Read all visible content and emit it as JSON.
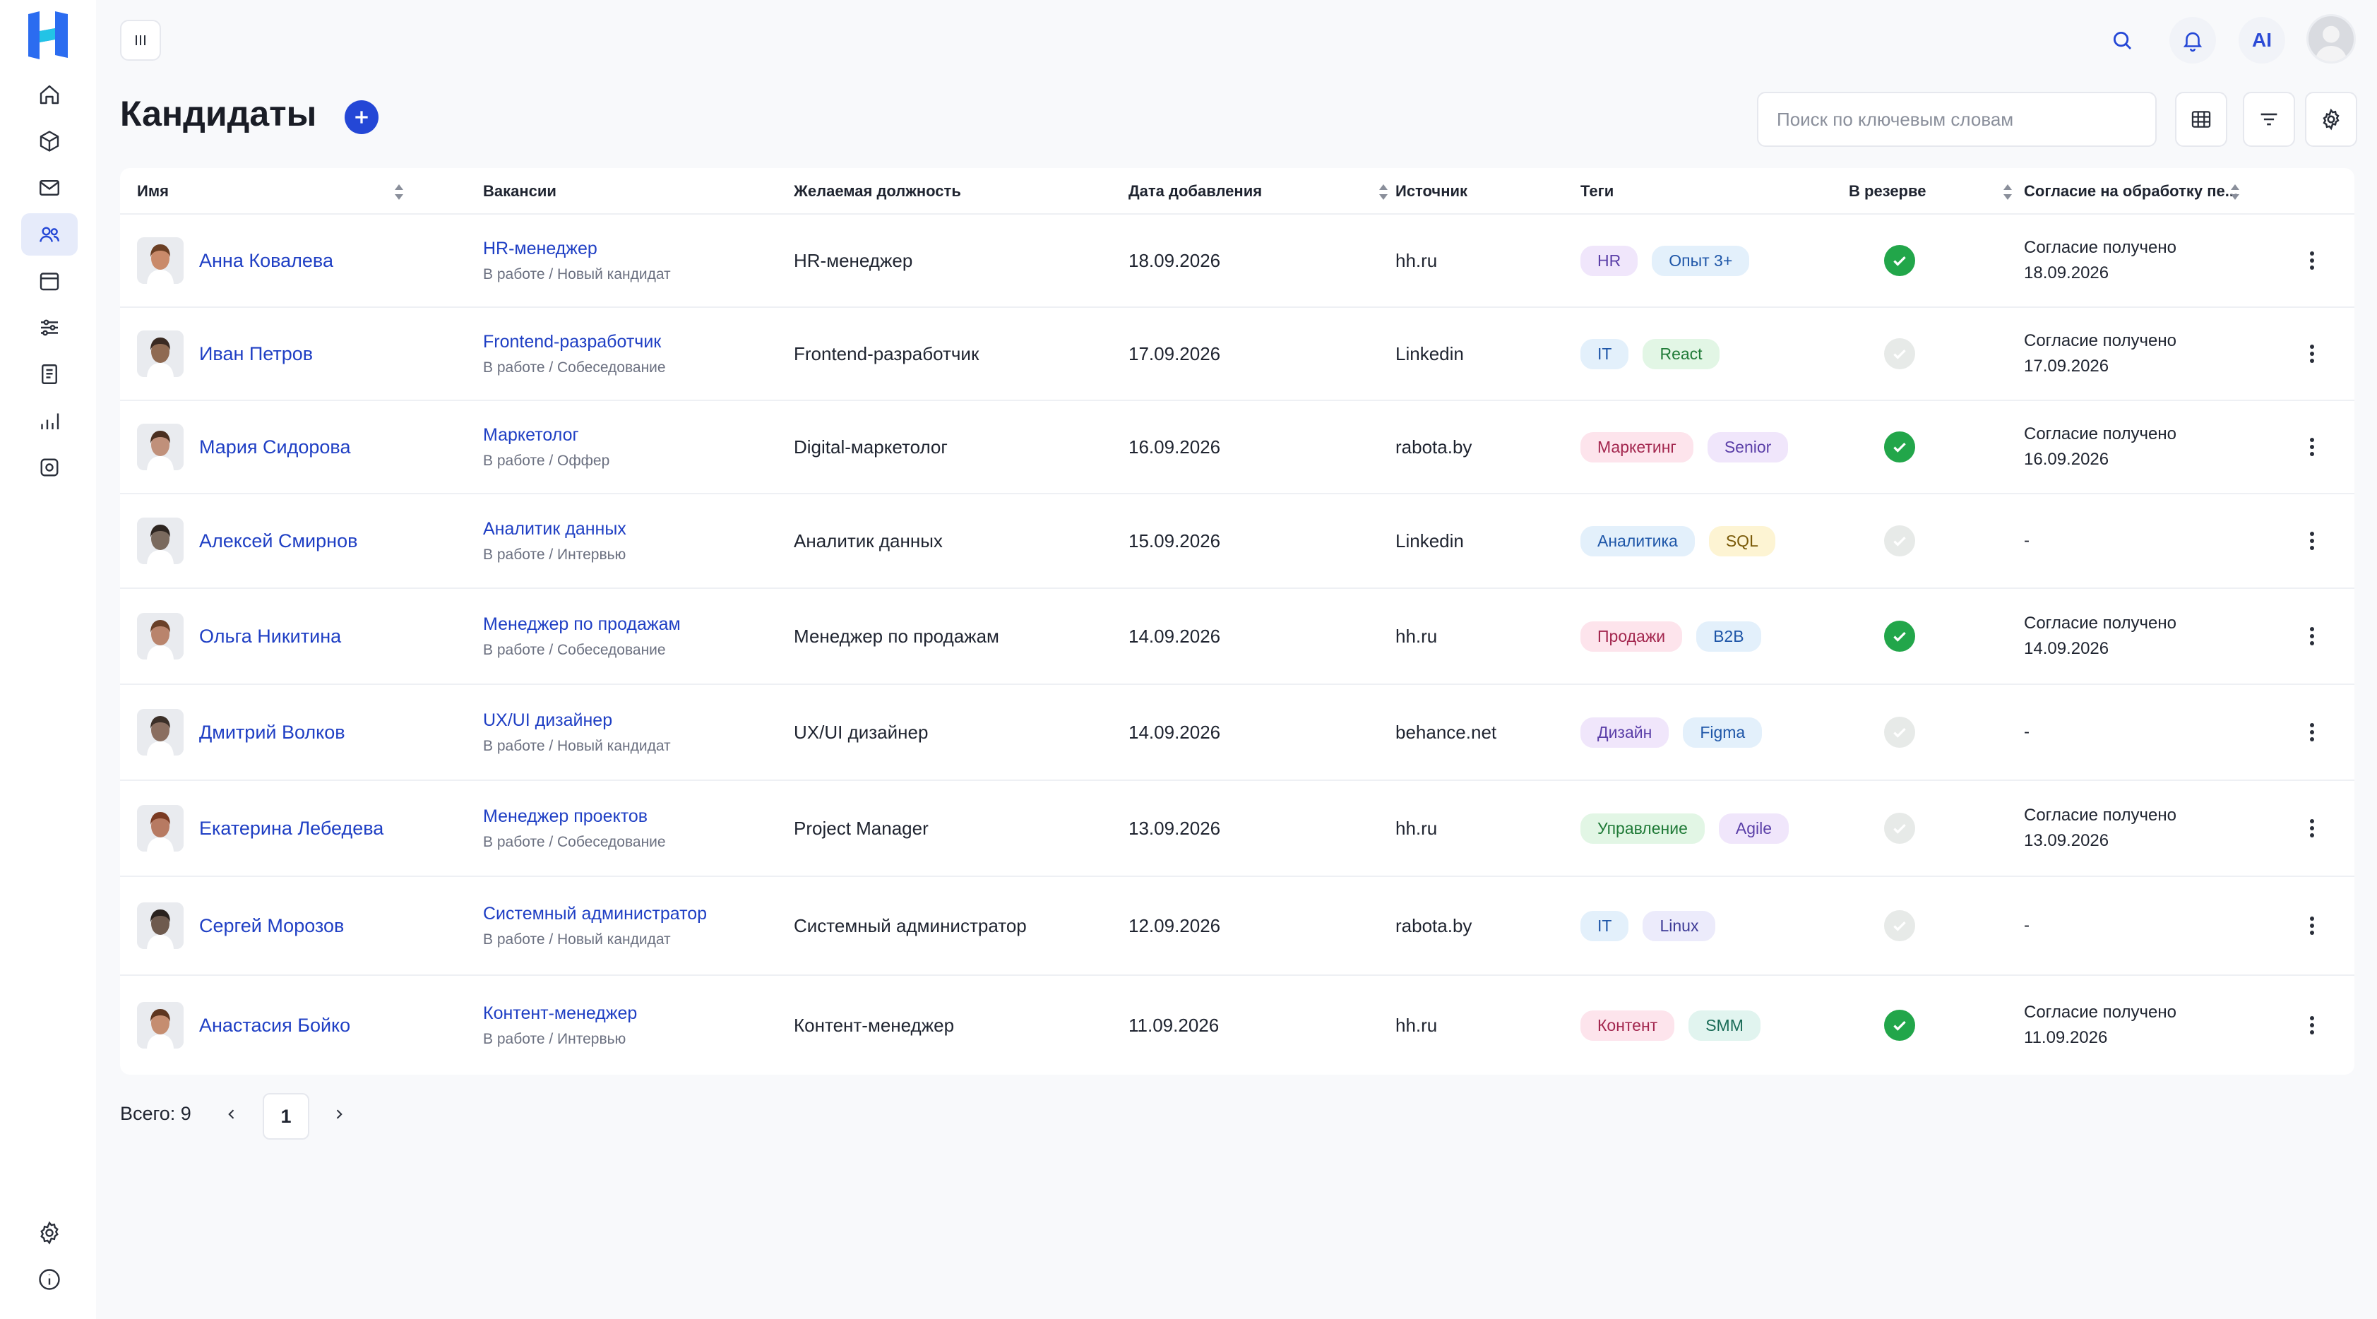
{
  "header": {
    "title": "Кандидаты",
    "ai_label": "AI",
    "search_placeholder": "Поиск по ключевым словам"
  },
  "sidebar": {
    "items": [
      {
        "icon": "home-icon"
      },
      {
        "icon": "cube-icon"
      },
      {
        "icon": "mail-icon"
      },
      {
        "icon": "users-icon",
        "active": true
      },
      {
        "icon": "calendar-icon"
      },
      {
        "icon": "sliders-icon"
      },
      {
        "icon": "document-icon"
      },
      {
        "icon": "bar-chart-icon"
      },
      {
        "icon": "cog-icon"
      }
    ],
    "bottom": [
      {
        "icon": "settings-icon"
      },
      {
        "icon": "info-icon"
      }
    ]
  },
  "table": {
    "columns": {
      "name": "Имя",
      "vacancies": "Вакансии",
      "position": "Желаемая должность",
      "date": "Дата добавления",
      "source": "Источник",
      "tags": "Теги",
      "reserve": "В резерве",
      "consent": "Согласие на обработку пе..."
    },
    "rows": [
      {
        "name": "Анна Ковалева",
        "vacancy": "HR-менеджер",
        "status": "В работе / Новый кандидат",
        "position": "HR-менеджер",
        "date": "18.09.2026",
        "source": "hh.ru",
        "tags": [
          {
            "label": "HR",
            "color": "purple"
          },
          {
            "label": "Опыт 3+",
            "color": "blue"
          }
        ],
        "reserve": true,
        "consent_line1": "Согласие получено",
        "consent_line2": "18.09.2026"
      },
      {
        "name": "Иван Петров",
        "vacancy": "Frontend-разработчик",
        "status": "В работе / Собеседование",
        "position": "Frontend-разработчик",
        "date": "17.09.2026",
        "source": "Linkedin",
        "tags": [
          {
            "label": "IT",
            "color": "blue"
          },
          {
            "label": "React",
            "color": "green"
          }
        ],
        "reserve": false,
        "consent_line1": "Согласие получено",
        "consent_line2": "17.09.2026"
      },
      {
        "name": "Мария Сидорова",
        "vacancy": "Маркетолог",
        "status": "В работе / Оффер",
        "position": "Digital-маркетолог",
        "date": "16.09.2026",
        "source": "rabota.by",
        "tags": [
          {
            "label": "Маркетинг",
            "color": "pink"
          },
          {
            "label": "Senior",
            "color": "purple"
          }
        ],
        "reserve": true,
        "consent_line1": "Согласие получено",
        "consent_line2": "16.09.2026"
      },
      {
        "name": "Алексей Смирнов",
        "vacancy": "Аналитик данных",
        "status": "В работе / Интервью",
        "position": "Аналитик данных",
        "date": "15.09.2026",
        "source": "Linkedin",
        "tags": [
          {
            "label": "Аналитика",
            "color": "blue"
          },
          {
            "label": "SQL",
            "color": "yellow"
          }
        ],
        "reserve": false,
        "consent_line1": "-",
        "consent_line2": ""
      },
      {
        "name": "Ольга Никитина",
        "vacancy": "Менеджер по продажам",
        "status": "В работе / Собеседование",
        "position": "Менеджер по продажам",
        "date": "14.09.2026",
        "source": "hh.ru",
        "tags": [
          {
            "label": "Продажи",
            "color": "pink"
          },
          {
            "label": "B2B",
            "color": "blue"
          }
        ],
        "reserve": true,
        "consent_line1": "Согласие получено",
        "consent_line2": "14.09.2026"
      },
      {
        "name": "Дмитрий Волков",
        "vacancy": "UX/UI дизайнер",
        "status": "В работе / Новый кандидат",
        "position": "UX/UI дизайнер",
        "date": "14.09.2026",
        "source": "behance.net",
        "tags": [
          {
            "label": "Дизайн",
            "color": "purple"
          },
          {
            "label": "Figma",
            "color": "blue"
          }
        ],
        "reserve": false,
        "consent_line1": "-",
        "consent_line2": ""
      },
      {
        "name": "Екатерина Лебедева",
        "vacancy": "Менеджер проектов",
        "status": "В работе / Собеседование",
        "position": "Project Manager",
        "date": "13.09.2026",
        "source": "hh.ru",
        "tags": [
          {
            "label": "Управление",
            "color": "green"
          },
          {
            "label": "Agile",
            "color": "purple"
          }
        ],
        "reserve": false,
        "consent_line1": "Согласие получено",
        "consent_line2": "13.09.2026"
      },
      {
        "name": "Сергей Морозов",
        "vacancy": "Системный администратор",
        "status": "В работе / Новый кандидат",
        "position": "Системный администратор",
        "date": "12.09.2026",
        "source": "rabota.by",
        "tags": [
          {
            "label": "IT",
            "color": "blue"
          },
          {
            "label": "Linux",
            "color": "lavender"
          }
        ],
        "reserve": false,
        "consent_line1": "-",
        "consent_line2": ""
      },
      {
        "name": "Анастасия Бойко",
        "vacancy": "Контент-менеджер",
        "status": "В работе / Интервью",
        "position": "Контент-менеджер",
        "date": "11.09.2026",
        "source": "hh.ru",
        "tags": [
          {
            "label": "Контент",
            "color": "pink"
          },
          {
            "label": "SMM",
            "color": "teal"
          }
        ],
        "reserve": true,
        "consent_line1": "Согласие получено",
        "consent_line2": "11.09.2026"
      }
    ]
  },
  "pagination": {
    "total": "Всего: 9",
    "current_page": "1"
  },
  "colors": {
    "accent": "#2447d6",
    "link": "#1f3fc4",
    "check_on": "#22a64a",
    "tag_purple": "#f0e6fb",
    "tag_blue": "#e3f0fb",
    "tag_green": "#e2f6e5",
    "tag_pink": "#fde4ec",
    "tag_yellow": "#fdf4d3",
    "tag_teal": "#e1f4ef",
    "tag_lavender": "#ecebfb"
  }
}
